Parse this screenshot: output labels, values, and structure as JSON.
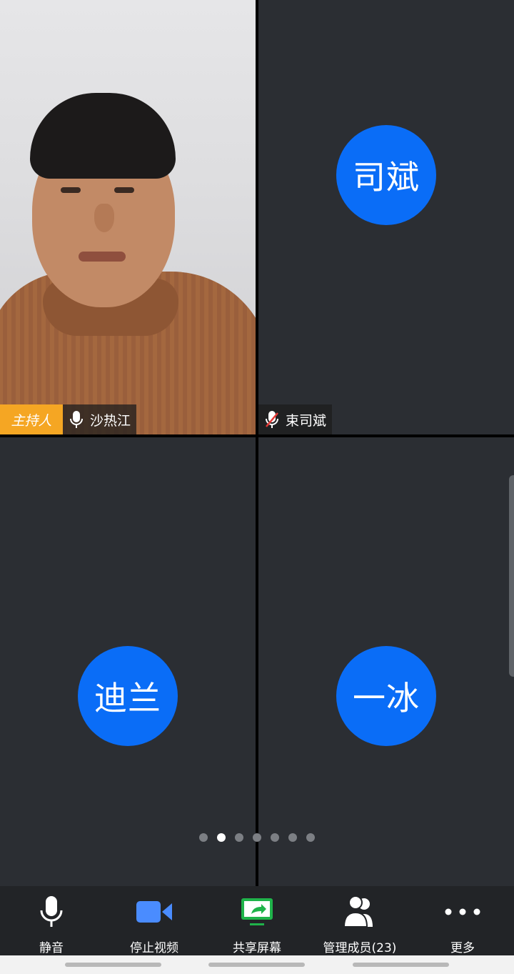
{
  "participants": [
    {
      "name": "沙热江",
      "role_label": "主持人",
      "avatar_text": "",
      "mic": "on"
    },
    {
      "name": "束司斌",
      "avatar_text": "司斌",
      "mic": "muted"
    },
    {
      "name": "",
      "avatar_text": "迪兰"
    },
    {
      "name": "",
      "avatar_text": "一冰"
    }
  ],
  "pagination": {
    "total_pages": 7,
    "current_page": 2
  },
  "toolbar": {
    "mute_label": "静音",
    "stop_video_label": "停止视频",
    "share_screen_label": "共享屏幕",
    "manage_members_label": "管理成员(23)",
    "more_label": "更多"
  },
  "colors": {
    "avatar_bg": "#0a6df7",
    "host_badge": "#f5a623",
    "video_icon": "#4a8cff",
    "share_icon": "#1fb34a",
    "tile_bg": "#2b2e33"
  }
}
